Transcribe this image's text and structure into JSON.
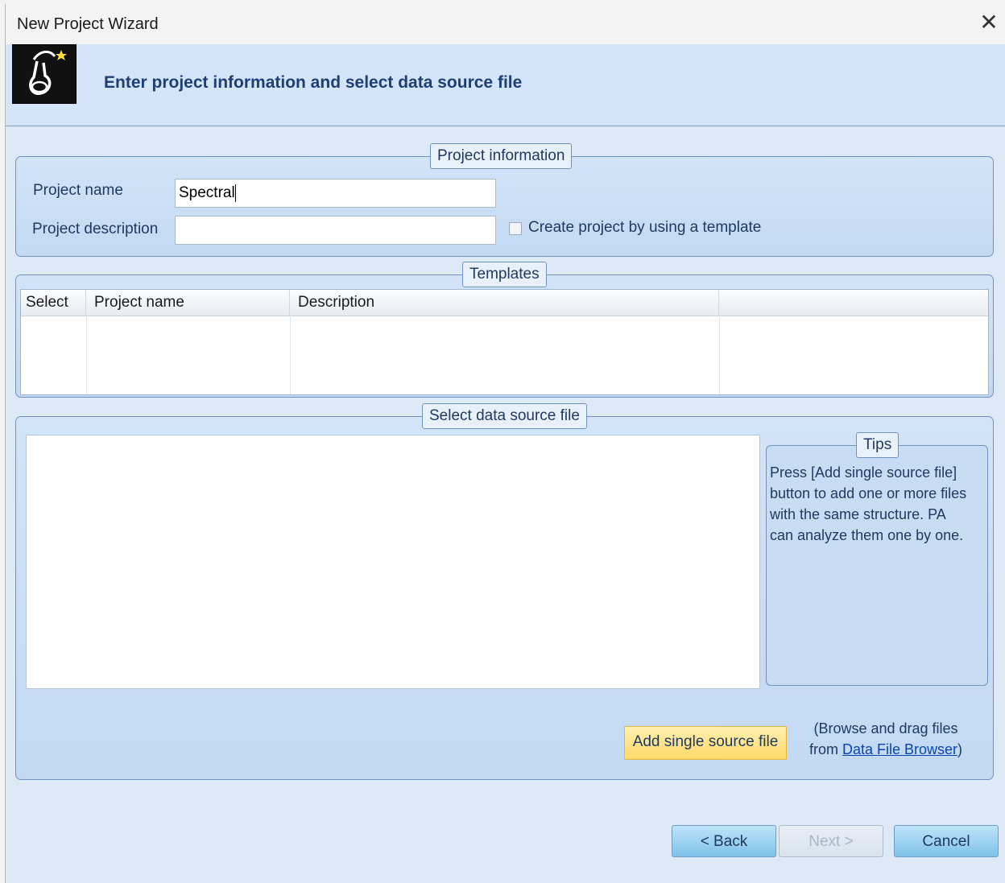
{
  "window": {
    "title": "New Project Wizard"
  },
  "banner": {
    "heading": "Enter project information and select data source file"
  },
  "project_info": {
    "legend": "Project information",
    "name_label": "Project name",
    "name_value": "Spectral",
    "description_label": "Project description",
    "description_value": "",
    "template_checkbox_label": "Create project by using a template",
    "template_checkbox_checked": false
  },
  "templates": {
    "legend": "Templates",
    "columns": [
      "Select",
      "Project name",
      "Description",
      ""
    ],
    "rows": []
  },
  "data_source": {
    "legend": "Select data source file",
    "tips_legend": "Tips",
    "tips_text": "Press [Add single source file] button to add one or more files with the same structure. PA can analyze them one by one.",
    "add_button_label": "Add single source file",
    "browse_note_line1": "(Browse and drag files",
    "browse_note_from": "from ",
    "browse_note_link": "Data File Browser",
    "browse_note_close": ")"
  },
  "footer": {
    "back_label": "< Back",
    "next_label": "Next >",
    "cancel_label": "Cancel"
  },
  "icons": {
    "close": "close-icon",
    "logo": "wizard-logo-icon"
  }
}
